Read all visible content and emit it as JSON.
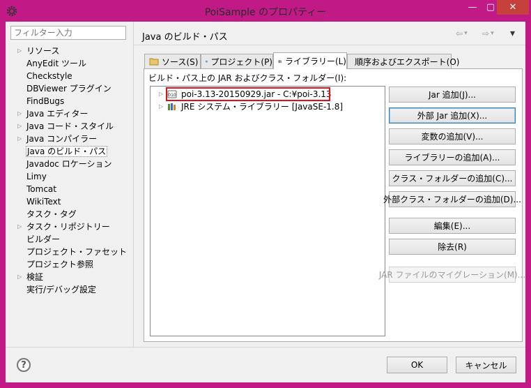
{
  "window": {
    "title": "PoiSample のプロパティー",
    "min": "—",
    "max": "▢",
    "close": "✕"
  },
  "filter": {
    "placeholder": "フィルター入力"
  },
  "nav_tree": [
    {
      "label": "リソース",
      "expandable": true
    },
    {
      "label": "AnyEdit ツール",
      "expandable": false
    },
    {
      "label": "Checkstyle",
      "expandable": false
    },
    {
      "label": "DBViewer プラグイン",
      "expandable": false
    },
    {
      "label": "FindBugs",
      "expandable": false
    },
    {
      "label": "Java エディター",
      "expandable": true
    },
    {
      "label": "Java コード・スタイル",
      "expandable": true
    },
    {
      "label": "Java コンパイラー",
      "expandable": true
    },
    {
      "label": "Java のビルド・パス",
      "expandable": false,
      "selected": true
    },
    {
      "label": "Javadoc ロケーション",
      "expandable": false
    },
    {
      "label": "Limy",
      "expandable": false
    },
    {
      "label": "Tomcat",
      "expandable": false
    },
    {
      "label": "WikiText",
      "expandable": false
    },
    {
      "label": "タスク・タグ",
      "expandable": false
    },
    {
      "label": "タスク・リポジトリー",
      "expandable": true
    },
    {
      "label": "ビルダー",
      "expandable": false
    },
    {
      "label": "プロジェクト・ファセット",
      "expandable": false
    },
    {
      "label": "プロジェクト参照",
      "expandable": false
    },
    {
      "label": "検証",
      "expandable": true
    },
    {
      "label": "実行/デバッグ設定",
      "expandable": false
    }
  ],
  "page": {
    "title": "Java のビルド・パス",
    "back": "⇦",
    "forward": "⇨",
    "menu": "▾"
  },
  "tabs": [
    {
      "label": "ソース(S)",
      "icon": "source-folder-icon"
    },
    {
      "label": "プロジェクト(P)",
      "icon": "project-icon"
    },
    {
      "label": "ライブラリー(L)",
      "icon": "library-icon",
      "active": true
    },
    {
      "label": "順序およびエクスポート(O)",
      "icon": "order-export-icon"
    }
  ],
  "libraries": {
    "label": "ビルド・パス上の JAR およびクラス・フォルダー(I):",
    "items": [
      {
        "text": "poi-3.13-20150929.jar - C:¥poi-3.13",
        "icon": "jar-file-icon",
        "highlighted": true
      },
      {
        "text": "JRE システム・ライブラリー [JavaSE-1.8]",
        "icon": "jre-library-icon",
        "highlighted": false
      }
    ]
  },
  "buttons": [
    {
      "label": "Jar 追加(J)...",
      "name": "add-jar-button"
    },
    {
      "label": "外部 Jar 追加(X)...",
      "name": "add-external-jar-button",
      "default": true
    },
    {
      "label": "変数の追加(V)...",
      "name": "add-variable-button"
    },
    {
      "label": "ライブラリーの追加(A)...",
      "name": "add-library-button"
    },
    {
      "label": "クラス・フォルダーの追加(C)...",
      "name": "add-class-folder-button"
    },
    {
      "label": "外部クラス・フォルダーの追加(D)...",
      "name": "add-external-class-folder-button"
    },
    {
      "label": "編集(E)...",
      "name": "edit-button"
    },
    {
      "label": "除去(R)",
      "name": "remove-button"
    },
    {
      "label": "JAR ファイルのマイグレーション(M)...",
      "name": "migrate-jar-button",
      "disabled": true
    }
  ],
  "footer": {
    "help": "?",
    "ok": "OK",
    "cancel": "キャンセル"
  },
  "colors": {
    "titlebar": "#c11a86",
    "highlight_border": "#e0101b",
    "close_button": "#c7413c"
  }
}
